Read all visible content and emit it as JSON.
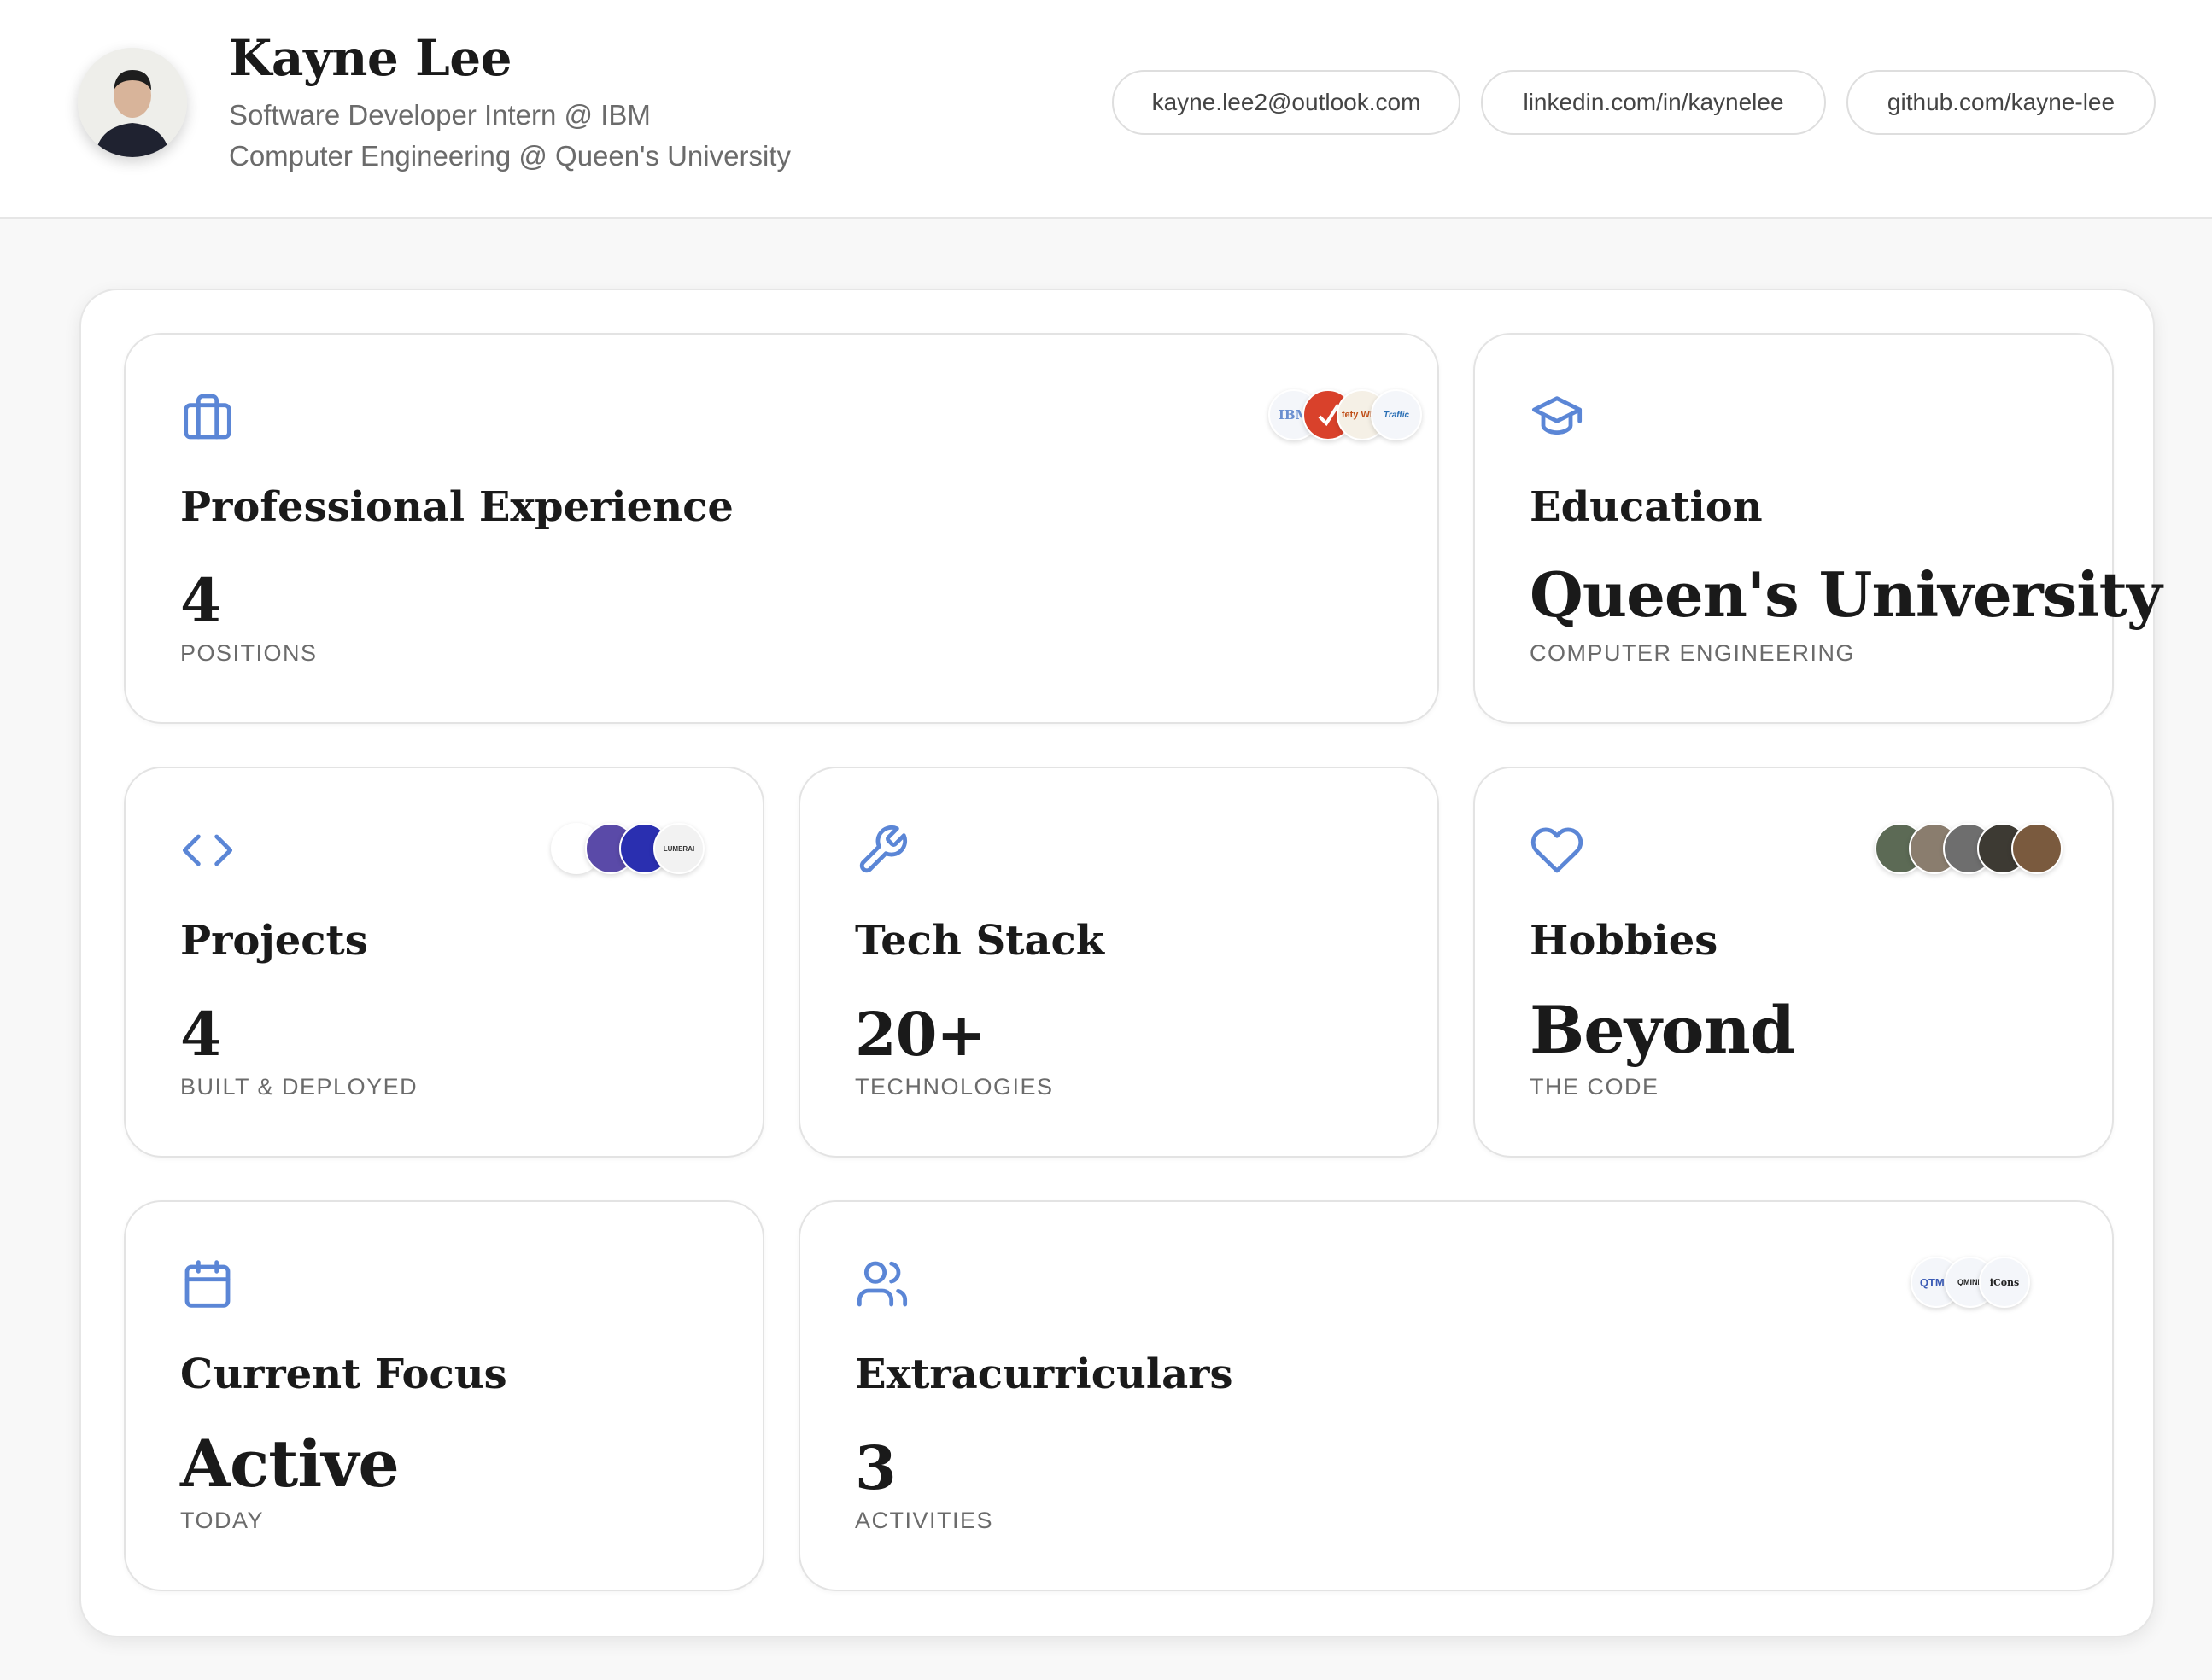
{
  "profile": {
    "name": "Kayne Lee",
    "role": "Software Developer Intern @ IBM",
    "education_line": "Computer Engineering @ Queen's University"
  },
  "contacts": [
    {
      "label": "kayne.lee2@outlook.com",
      "icon": "mail"
    },
    {
      "label": "linkedin.com/in/kaynelee",
      "icon": "linkedin"
    },
    {
      "label": "github.com/kayne-lee",
      "icon": "github"
    }
  ],
  "cards": {
    "experience": {
      "title": "Professional Experience",
      "value": "4",
      "caption": "POSITIONS",
      "icon": "briefcase-icon",
      "logos": [
        "IBM",
        "",
        "fety WER",
        "Traffic"
      ]
    },
    "education": {
      "title": "Education",
      "value": "Queen's University",
      "caption": "COMPUTER ENGINEERING",
      "icon": "graduation-cap-icon"
    },
    "projects": {
      "title": "Projects",
      "value": "4",
      "caption": "BUILT & DEPLOYED",
      "icon": "code-icon",
      "logos": [
        "",
        "",
        "",
        "LUMERAI"
      ]
    },
    "tech": {
      "title": "Tech Stack",
      "value": "20+",
      "caption": "TECHNOLOGIES",
      "icon": "wrench-icon"
    },
    "hobbies": {
      "title": "Hobbies",
      "value": "Beyond",
      "caption": "THE CODE",
      "icon": "heart-icon"
    },
    "focus": {
      "title": "Current Focus",
      "value": "Active",
      "caption": "TODAY",
      "icon": "calendar-icon"
    },
    "extracurriculars": {
      "title": "Extracurriculars",
      "value": "3",
      "caption": "ACTIVITIES",
      "icon": "users-icon",
      "logos": [
        "QTMA",
        "QMIND",
        "iCons"
      ]
    }
  },
  "colors": {
    "accent": "#5b86d6",
    "text": "#1a1a1a",
    "muted": "#6b6b6b",
    "border": "#e3e3e3"
  }
}
